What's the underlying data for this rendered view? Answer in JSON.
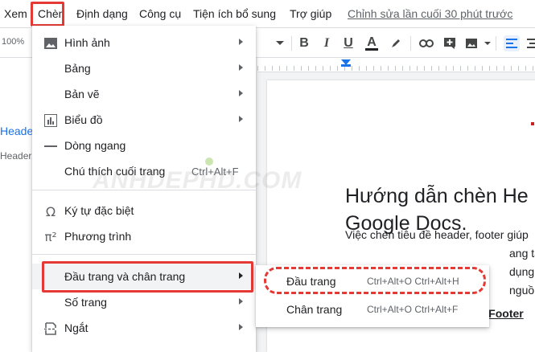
{
  "menubar": {
    "items": [
      "Xem",
      "Chèn",
      "Định dạng",
      "Công cụ",
      "Tiện ích bổ sung",
      "Trợ giúp"
    ],
    "last_edit": "Chỉnh sửa lần cuối 30 phút trước"
  },
  "toolbar": {
    "zoom": "100%",
    "text_color_glyph": "A"
  },
  "outline": {
    "item1": "Header, F",
    "item2": "Header, F"
  },
  "document": {
    "title_line1": "Hướng dẫn chèn He",
    "title_line2": "Google Docs.",
    "para_line1": "Việc chèn tiêu đề header, footer giúp",
    "para_line2": "ang tài liệ",
    "para_line3": "dụng cũ",
    "para_line4": "nguồn g",
    "heading": "Cách chèn tiêu đề Header, Footer"
  },
  "insert_menu": {
    "items": [
      {
        "label": "Hình ảnh",
        "icon": "image-icon"
      },
      {
        "label": "Bảng",
        "icon": ""
      },
      {
        "label": "Bản vẽ",
        "icon": ""
      },
      {
        "label": "Biểu đồ",
        "icon": "chart-icon"
      },
      {
        "label": "Dòng ngang",
        "icon": "horizontal-line-icon"
      },
      {
        "label": "Chú thích cuối trang",
        "icon": "",
        "shortcut": "Ctrl+Alt+F"
      },
      {
        "label": "Ký tự đặc biệt",
        "icon": "omega-icon"
      },
      {
        "label": "Phương trình",
        "icon": "pi-icon"
      },
      {
        "label": "Đầu trang và chân trang",
        "icon": ""
      },
      {
        "label": "Số trang",
        "icon": ""
      },
      {
        "label": "Ngắt",
        "icon": "page-break-icon"
      }
    ]
  },
  "header_footer_submenu": {
    "items": [
      {
        "label": "Đầu trang",
        "shortcut": "Ctrl+Alt+O Ctrl+Alt+H"
      },
      {
        "label": "Chân trang",
        "shortcut": "Ctrl+Alt+O Ctrl+Alt+F"
      }
    ]
  },
  "watermark": "ANHDEPHD.COM",
  "colors": {
    "highlight_border": "#e53935",
    "accent_blue": "#1a73e8",
    "menu_hover": "#f1f3f4"
  }
}
